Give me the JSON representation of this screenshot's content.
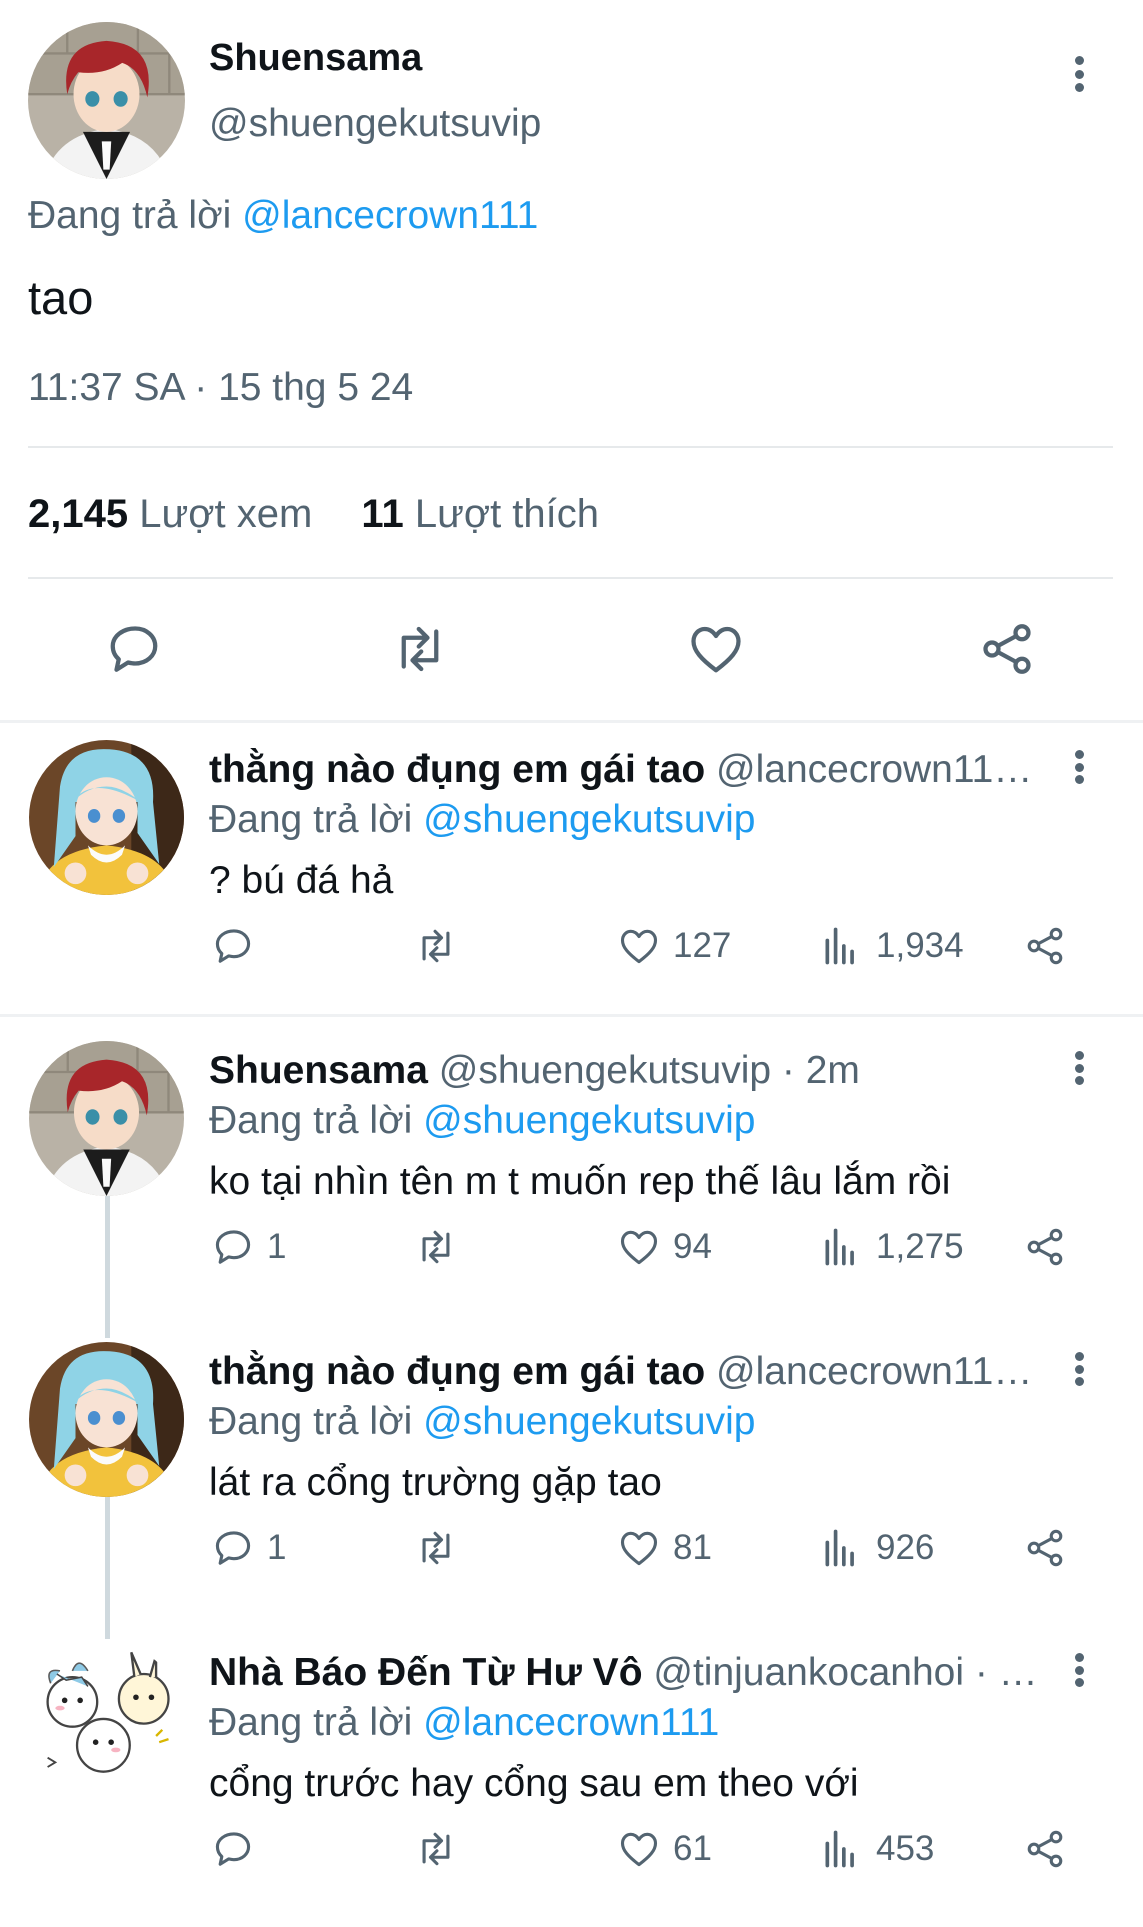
{
  "main_tweet": {
    "display_name": "Shuensama",
    "handle": "@shuengekutsuvip",
    "replying_prefix": "Đang trả lời",
    "replying_to": "@lancecrown111",
    "text": "tao",
    "timestamp": "11:37 SA · 15 thg 5 24",
    "views_count": "2,145",
    "views_label": "Lượt xem",
    "likes_count": "11",
    "likes_label": "Lượt thích"
  },
  "replies": [
    {
      "display_name": "thằng nào đụng em gái tao",
      "handle": "@lancecrown11…",
      "replying_prefix": "Đang trả lời",
      "replying_to": "@shuengekutsuvip",
      "text": "? bú đá hả",
      "replies": "",
      "likes": "127",
      "views": "1,934"
    },
    {
      "display_name": "Shuensama",
      "handle": "@shuengekutsuvip · 2m",
      "replying_prefix": "Đang trả lời",
      "replying_to": "@shuengekutsuvip",
      "text": "ko tại nhìn tên m t muốn rep thế lâu lắm rồi",
      "replies": "1",
      "likes": "94",
      "views": "1,275"
    },
    {
      "display_name": "thằng nào đụng em gái tao",
      "handle": "@lancecrown11…",
      "replying_prefix": "Đang trả lời",
      "replying_to": "@shuengekutsuvip",
      "text": "lát ra cổng trường gặp tao",
      "replies": "1",
      "likes": "81",
      "views": "926"
    },
    {
      "display_name": "Nhà Báo Đến Từ Hư Vô",
      "handle": "@tinjuankocanhoi · …",
      "replying_prefix": "Đang trả lời",
      "replying_to": "@lancecrown111",
      "text": "cổng trước hay cổng sau em theo với",
      "replies": "",
      "likes": "61",
      "views": "453"
    }
  ],
  "colors": {
    "text": "#0f1419",
    "muted": "#536471",
    "link": "#1d9bf0",
    "divider": "#eff1f3"
  }
}
